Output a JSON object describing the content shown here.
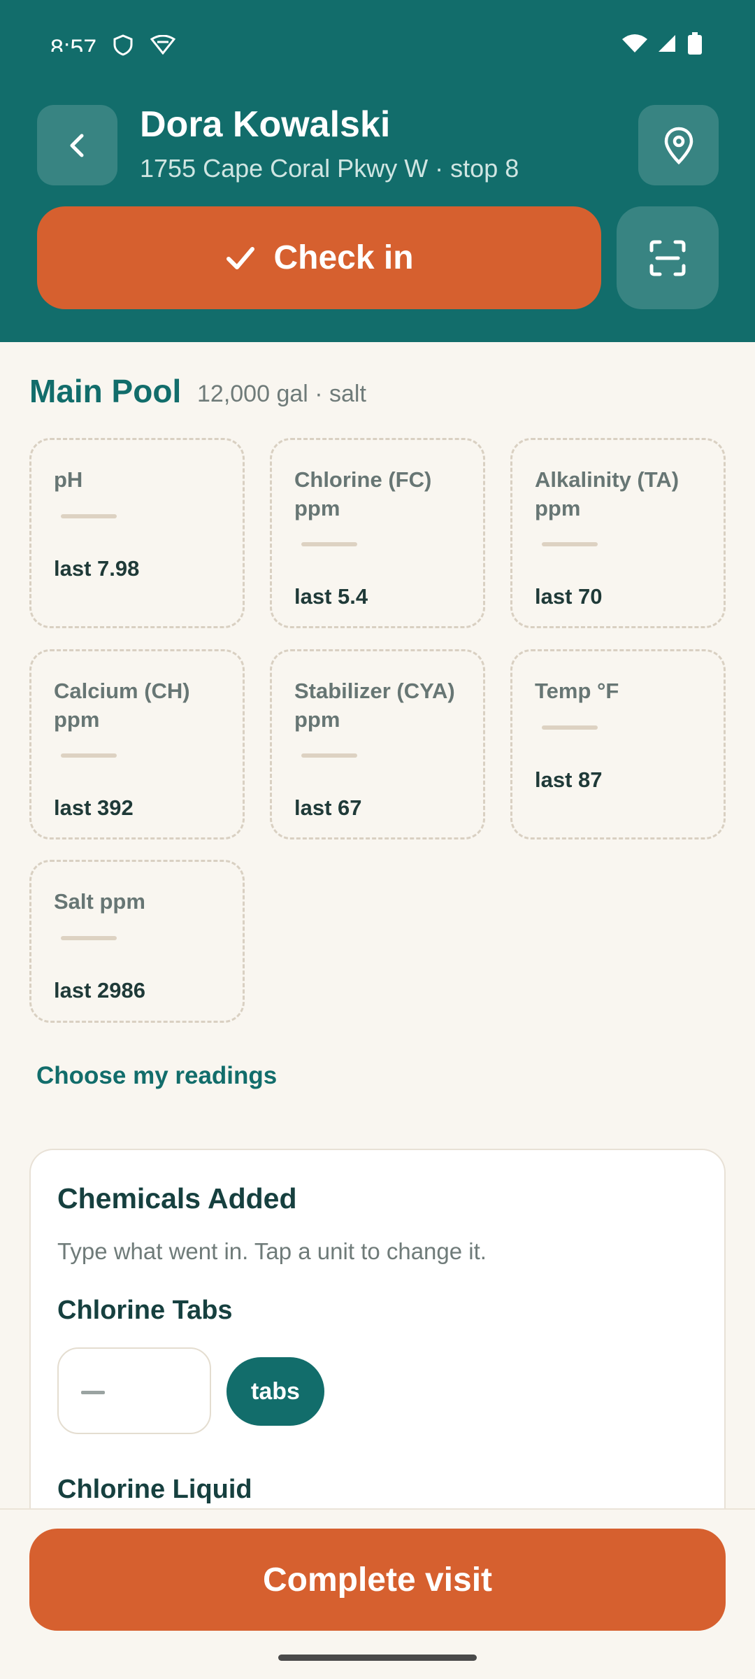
{
  "status_bar": {
    "time": "8:57"
  },
  "header": {
    "title": "Dora Kowalski",
    "subtitle": "1755 Cape Coral Pkwy W · stop 8",
    "checkin_label": "Check in"
  },
  "pool": {
    "name": "Main Pool",
    "meta": "12,000 gal · salt"
  },
  "readings": [
    {
      "label": "pH",
      "last": "last 7.98"
    },
    {
      "label": "Chlorine (FC) ppm",
      "last": "last 5.4"
    },
    {
      "label": "Alkalinity (TA) ppm",
      "last": "last 70"
    },
    {
      "label": "Calcium (CH) ppm",
      "last": "last 392"
    },
    {
      "label": "Stabilizer (CYA) ppm",
      "last": "last 67"
    },
    {
      "label": "Temp °F",
      "last": "last 87"
    },
    {
      "label": "Salt ppm",
      "last": "last 2986"
    }
  ],
  "choose_readings": "Choose my readings",
  "chemicals": {
    "title": "Chemicals Added",
    "subtitle": "Type what went in. Tap a unit to change it.",
    "items": [
      {
        "name": "Chlorine Tabs",
        "unit": "tabs"
      },
      {
        "name": "Chlorine Liquid"
      }
    ]
  },
  "complete_label": "Complete visit",
  "colors": {
    "header": "#126d6b",
    "accent": "#d6602f",
    "background": "#f9f6f0"
  }
}
